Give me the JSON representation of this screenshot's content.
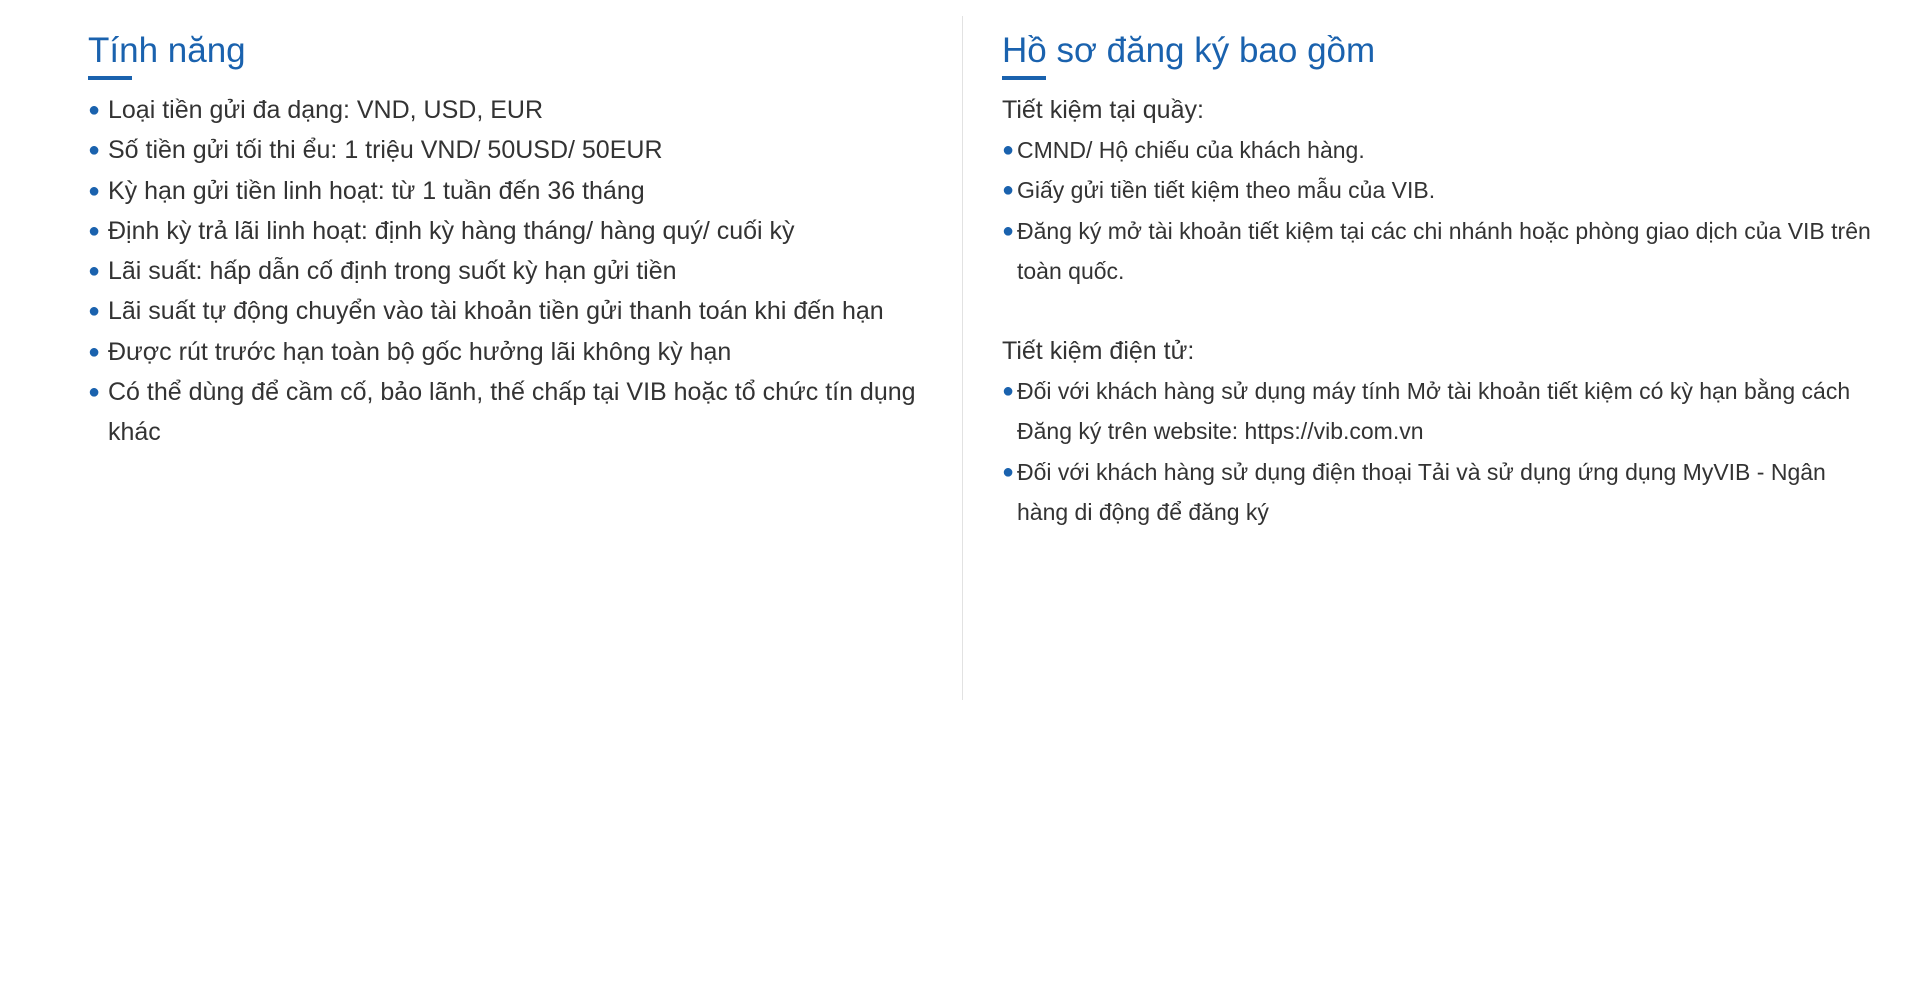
{
  "features": {
    "title": "Tính năng",
    "items": [
      "Loại tiền gửi đa dạng: VND, USD, EUR",
      "Số tiền gửi tối thi  ểu: 1 triệu VND/ 50USD/ 50EUR",
      "Kỳ hạn gửi tiền linh hoạt: từ 1 tuần đến 36 tháng",
      "Định kỳ trả lãi linh hoạt: định kỳ hàng tháng/ hàng quý/ cuối kỳ",
      "Lãi suất: hấp dẫn cố định trong suốt kỳ hạn gửi tiền",
      "Lãi suất tự động chuyển vào tài khoản tiền gửi thanh toán khi đến hạn",
      "Được rút trước hạn toàn bộ gốc hưởng lãi không kỳ hạn",
      "Có thể dùng để cầm cố, bảo lãnh, thế chấp tại VIB hoặc tổ chức tín dụng khác"
    ]
  },
  "documents": {
    "title": "Hồ sơ đăng ký bao gồm",
    "counter": {
      "heading": "Tiết kiệm tại quầy:",
      "items": [
        "CMND/ Hộ chiếu của khách hàng.",
        "Giấy gửi tiền tiết kiệm theo mẫu của VIB.",
        "Đăng ký mở tài khoản tiết kiệm tại các chi nhánh hoặc phòng giao dịch của VIB trên toàn quốc."
      ]
    },
    "online": {
      "heading": "Tiết kiệm điện tử:",
      "items": [
        "Đối với khách hàng sử dụng máy tính Mở tài khoản tiết kiệm có kỳ hạn bằng cách Đăng ký trên website: https://vib.com.vn",
        "Đối với khách hàng sử dụng điện thoại Tải và sử dụng ứng dụng MyVIB - Ngân hàng di động để đăng ký"
      ]
    }
  },
  "colors": {
    "accent": "#1a62ae",
    "text": "#333333",
    "divider": "#e2e2e2"
  },
  "icons": {
    "bullet": "bullet-dot-icon"
  }
}
